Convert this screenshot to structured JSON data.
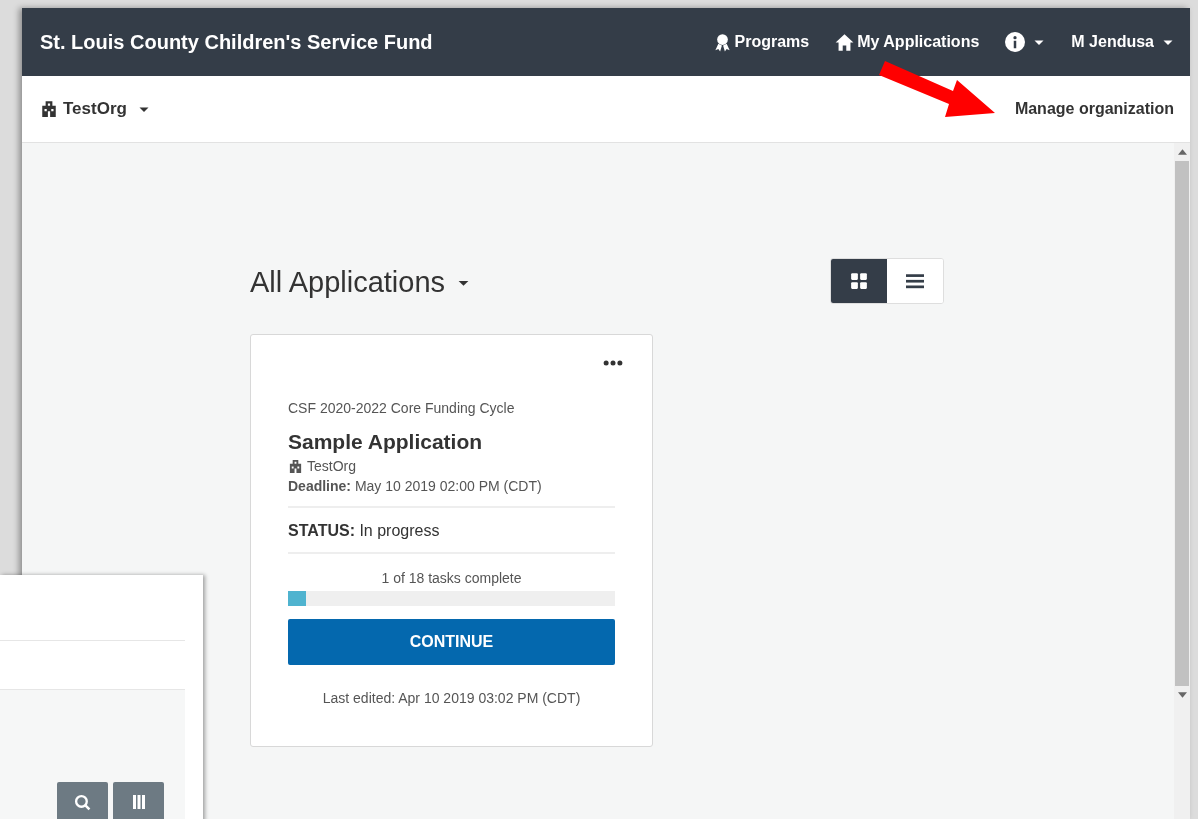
{
  "navbar": {
    "title": "St. Louis County Children's Service Fund",
    "links": [
      {
        "label": "Programs"
      },
      {
        "label": "My Applications"
      }
    ],
    "user_menu": "M Jendusa"
  },
  "subbar": {
    "organization": "TestOrg",
    "manage_link": "Manage organization"
  },
  "heading": "All Applications",
  "view_toggle": [
    {
      "kind": "grid",
      "selected": true
    },
    {
      "kind": "list",
      "selected": false
    }
  ],
  "application_card": {
    "program": "CSF 2020-2022 Core Funding Cycle",
    "title": "Sample Application",
    "organization": "TestOrg",
    "deadline_label": "Deadline:",
    "deadline": "May 10 2019 02:00 PM (CDT)",
    "status_label": "STATUS:",
    "status": "In progress",
    "progress_text": "1 of 18 tasks complete",
    "level": 0.056,
    "button": "CONTINUE",
    "last_edited": "Last edited: Apr 10 2019 03:02 PM (CDT)"
  }
}
